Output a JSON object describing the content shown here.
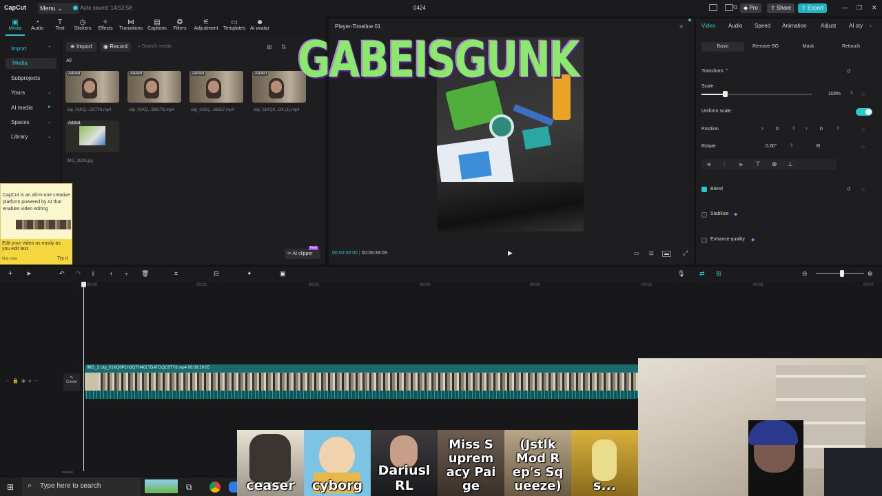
{
  "app": {
    "logo": "CapCut",
    "menu": "Menu",
    "autosave": "Auto saved: 14:52:58",
    "project": "0424",
    "pro": "Pro",
    "share": "Share",
    "export": "Export"
  },
  "toolbar": [
    "Media",
    "Audio",
    "Text",
    "Stickers",
    "Effects",
    "Transitions",
    "Captions",
    "Filters",
    "Adjustment",
    "Templates",
    "AI avatar"
  ],
  "nav": {
    "import": "Import",
    "media": "Media",
    "subprojects": "Subprojects",
    "yours": "Yours",
    "ai_media": "AI media",
    "spaces": "Spaces",
    "library": "Library"
  },
  "media": {
    "import_btn": "Import",
    "record_btn": "Record",
    "search_placeholder": "Search media",
    "filter_all": "All",
    "added": "Added",
    "files": [
      "clip_01KQ...C8TY8.mp4",
      "clip_01KQ...B9G7G.mp4",
      "clip_01KQ...88167.mp4",
      "clip_01KQ0...DK (1).mp4",
      "IMG_3829.jpg"
    ]
  },
  "promo": {
    "text": "CapCut is an all-in-one creative platform powered by AI that enables video editing",
    "bottom": "Edit your video as easily as you edit text.",
    "not_now": "Not now",
    "try_it": "Try it"
  },
  "ai_clipper": "AI clipper",
  "free_badge": "Free",
  "player": {
    "title": "Player-Timeline 01",
    "current": "00:00:00:00",
    "total": "00:09:39:09",
    "overlay_text": "GABEISGUNK"
  },
  "right": {
    "tabs": [
      "Video",
      "Audio",
      "Speed",
      "Animation",
      "Adjust",
      "AI sty"
    ],
    "subtabs": [
      "Basic",
      "Remove BG",
      "Mask",
      "Retouch"
    ],
    "transform": "Transform",
    "scale": "Scale",
    "scale_value": "100%",
    "scale_fraction": 0.21,
    "uniform_scale": "Uniform scale",
    "position": "Position",
    "pos_x_label": "X",
    "pos_x": "0",
    "pos_y_label": "Y",
    "pos_y": "0",
    "rotate": "Rotate",
    "rotate_value": "0.00°",
    "blend": "Blend",
    "stabilize": "Stabilize",
    "enhance": "Enhance quality"
  },
  "timeline": {
    "ruler": [
      "00:00",
      "00:01",
      "00:02",
      "00:03",
      "00:04",
      "00:05",
      "00:06",
      "00:07"
    ],
    "clip_label": "IMG_3 clip_01KQ0P1H3QTH401TDATGQC8TY8.mp4  00:09:29:05",
    "cover": "Cover"
  },
  "stream": {
    "tiles": [
      "ceaser",
      "cyborg",
      "Dariusl RL",
      "Miss S uprem acy Pai ge",
      "(Jstlk Mod R ep's Sq ueeze)",
      "s..."
    ]
  },
  "taskbar": {
    "search": "Type here to search"
  },
  "colors": {
    "accent": "#2ec8cc",
    "export": "#1fb3c0",
    "overlay_green": "#8be86a",
    "overlay_purple": "#6a2da8"
  }
}
